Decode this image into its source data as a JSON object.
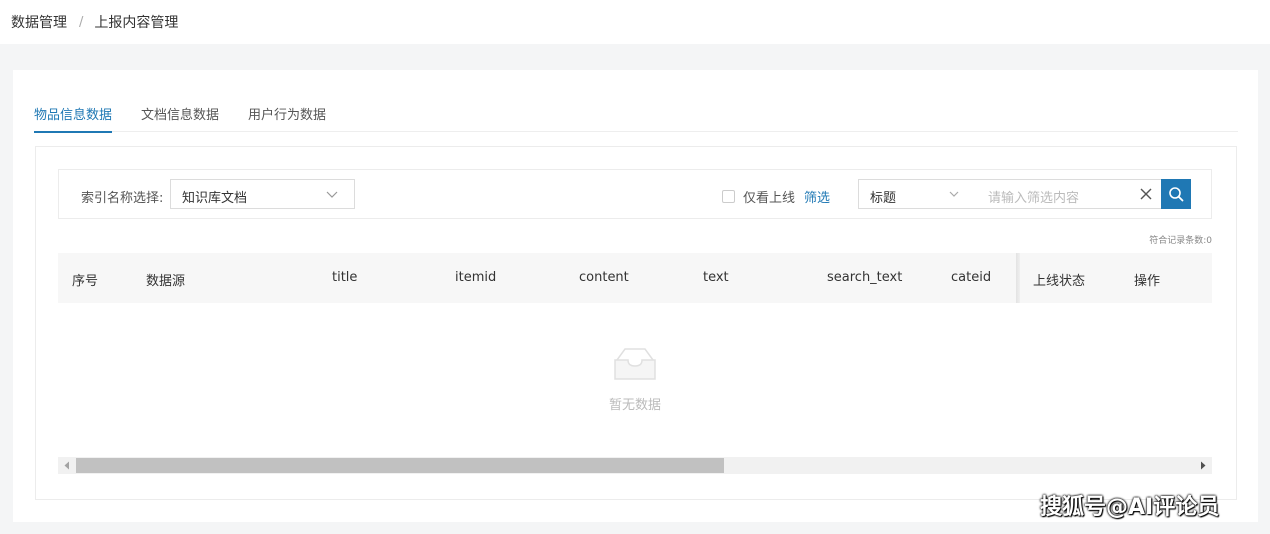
{
  "breadcrumb": {
    "root": "数据管理",
    "separator": "/",
    "current": "上报内容管理"
  },
  "tabs": [
    {
      "label": "物品信息数据",
      "active": true
    },
    {
      "label": "文档信息数据",
      "active": false
    },
    {
      "label": "用户行为数据",
      "active": false
    }
  ],
  "filter": {
    "index_label": "索引名称选择:",
    "index_value": "知识库文档",
    "online_only_label": "仅看上线",
    "online_only_checked": false,
    "filter_link": "筛选",
    "field_select_value": "标题",
    "search_placeholder": "请输入筛选内容"
  },
  "result_count": "符合记录条数:0",
  "table": {
    "columns": [
      "序号",
      "数据源",
      "title",
      "itemid",
      "content",
      "text",
      "search_text",
      "cateid",
      "上线状态",
      "操作"
    ],
    "rows": []
  },
  "empty_text": "暂无数据",
  "scrollbar": {
    "thumb_fraction": 0.58
  },
  "watermark": "搜狐号@AI评论员",
  "colors": {
    "accent": "#1f78b4",
    "header_bg": "#f7f7f7",
    "page_bg": "#f4f5f6"
  }
}
